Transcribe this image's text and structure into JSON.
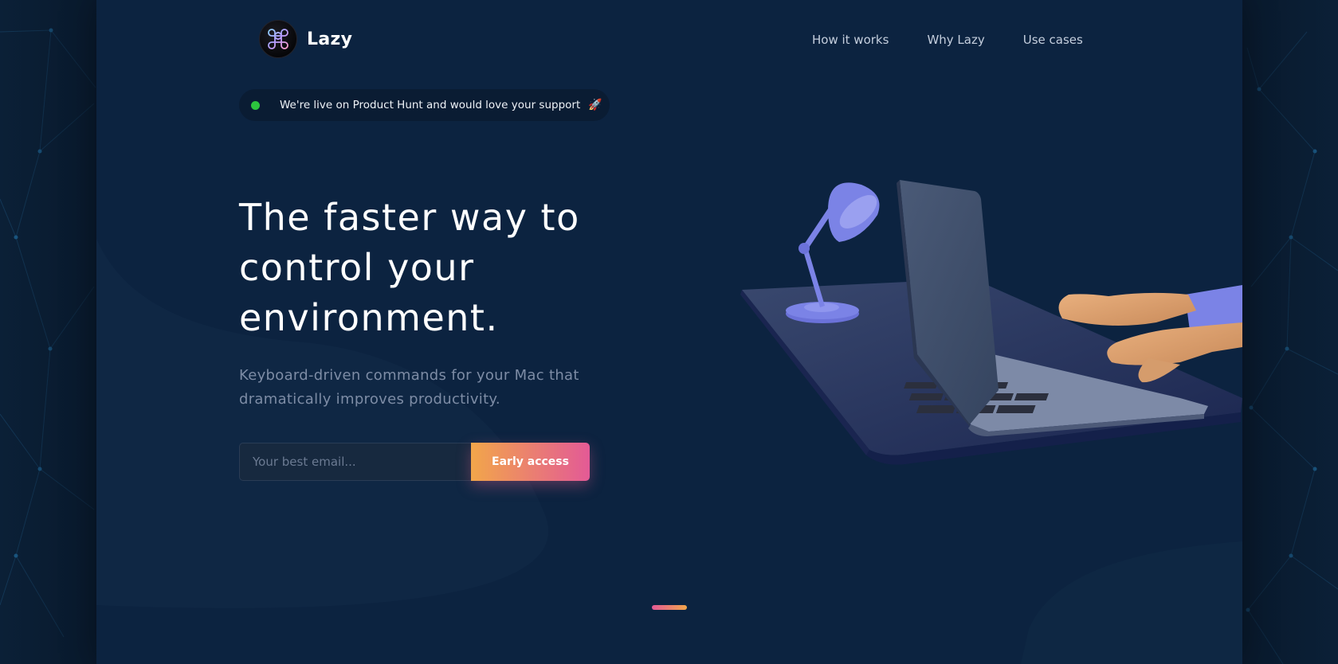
{
  "brand": {
    "name": "Lazy",
    "logo_icon": "command-icon"
  },
  "nav": {
    "items": [
      "How it works",
      "Why Lazy",
      "Use cases"
    ]
  },
  "announcement": {
    "text": "We're live on Product Hunt and would love your support",
    "emoji": "🚀",
    "status_color": "#2cc43e"
  },
  "hero": {
    "title": "The faster way to control your environment.",
    "subtitle": "Keyboard-driven commands for your Mac that dramatically improves productivity."
  },
  "signup": {
    "email_placeholder": "Your best email...",
    "email_value": "",
    "button_label": "Early access"
  },
  "colors": {
    "background": "#0b2037",
    "panel": "#0c2340",
    "accent_start": "#f2a64a",
    "accent_end": "#e35a96",
    "illustration_purple": "#7b83e6"
  },
  "carousel": {
    "slides": 1,
    "active": 1
  }
}
